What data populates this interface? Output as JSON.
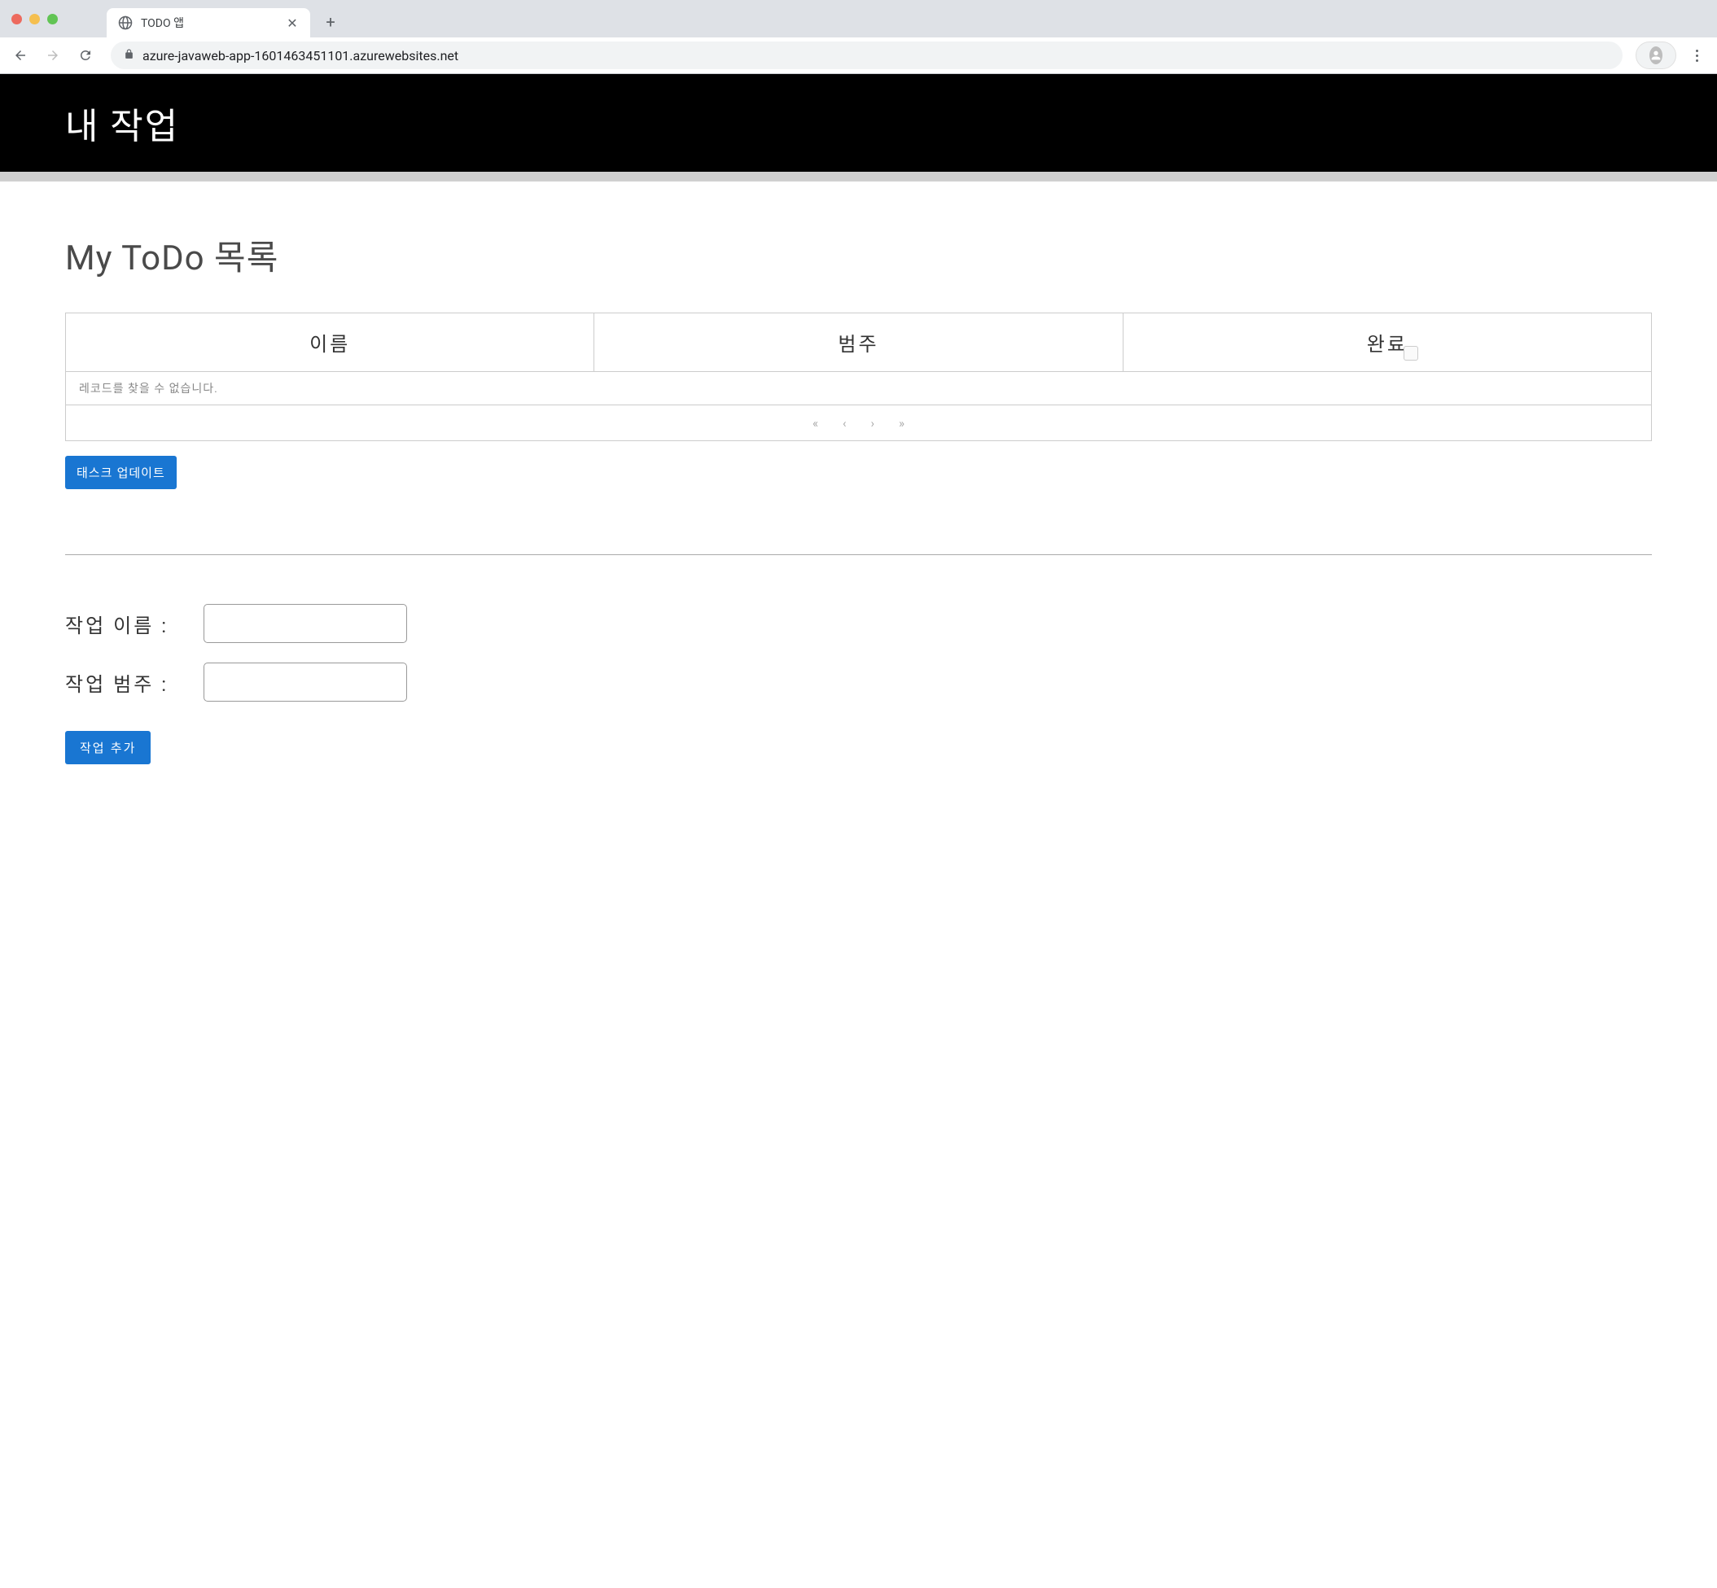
{
  "browser": {
    "tab_title": "TODO 앱",
    "url": "azure-javaweb-app-1601463451101.azurewebsites.net"
  },
  "header": {
    "title": "내 작업"
  },
  "main": {
    "heading": "My ToDo 목록",
    "table": {
      "columns": {
        "name": "이름",
        "category": "범주",
        "complete": "완료"
      },
      "empty_message": "레코드를 찾을 수 없습니다."
    },
    "update_button": "태스크 업데이트"
  },
  "form": {
    "name_label": "작업 이름 :",
    "category_label": "작업 범주 :",
    "name_value": "",
    "category_value": "",
    "add_button": "작업 추가"
  }
}
